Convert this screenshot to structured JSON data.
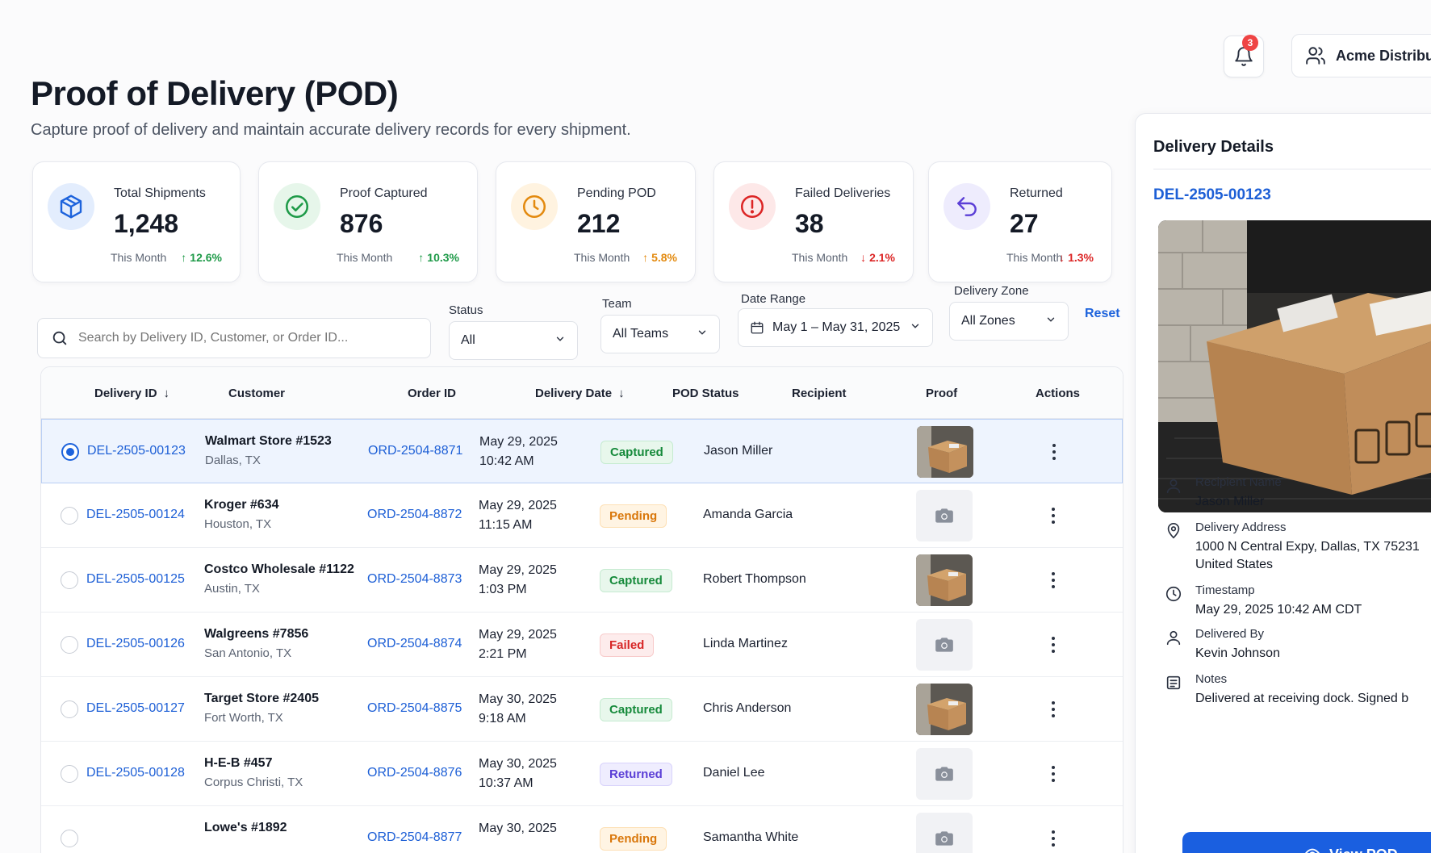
{
  "header": {
    "title": "Proof of Delivery (POD)",
    "subtitle": "Capture proof of delivery and maintain accurate delivery records for every shipment."
  },
  "topbar": {
    "notification_count": "3",
    "org_name": "Acme Distributi"
  },
  "stats": [
    {
      "label": "Total Shipments",
      "value": "1,248",
      "period": "This Month",
      "change": "12.6%",
      "direction": "up",
      "color": "#1e9a48",
      "icon": "cube-icon"
    },
    {
      "label": "Proof Captured",
      "value": "876",
      "period": "This Month",
      "change": "10.3%",
      "direction": "up",
      "color": "#1e9a48",
      "icon": "check-circle-icon"
    },
    {
      "label": "Pending POD",
      "value": "212",
      "period": "This Month",
      "change": "5.8%",
      "direction": "up",
      "color": "#e38a0f",
      "icon": "clock-icon"
    },
    {
      "label": "Failed Deliveries",
      "value": "38",
      "period": "This Month",
      "change": "2.1%",
      "direction": "down",
      "color": "#dc2626",
      "icon": "alert-circle-icon"
    },
    {
      "label": "Returned",
      "value": "27",
      "period": "This Month",
      "change": "1.3%",
      "direction": "down",
      "color": "#dc2626",
      "icon": "return-arrow-icon"
    }
  ],
  "filters": {
    "search_placeholder": "Search by Delivery ID, Customer, or Order ID...",
    "status_label": "Status",
    "status_value": "All",
    "team_label": "Team",
    "team_value": "All Teams",
    "date_label": "Date Range",
    "date_value": "May 1 – May 31, 2025",
    "zone_label": "Delivery Zone",
    "zone_value": "All Zones",
    "reset_label": "Reset"
  },
  "table": {
    "columns": {
      "delivery_id": "Delivery ID",
      "customer": "Customer",
      "order_id": "Order ID",
      "delivery_date": "Delivery Date",
      "pod_status": "POD Status",
      "recipient": "Recipient",
      "proof": "Proof",
      "actions": "Actions"
    },
    "rows": [
      {
        "id": "DEL-2505-00123",
        "customer": "Walmart Store #1523",
        "city": "Dallas, TX",
        "order": "ORD-2504-8871",
        "date": "May 29, 2025",
        "time": "10:42 AM",
        "status": "Captured",
        "status_class": "captured",
        "recipient": "Jason Miller",
        "proof": "photo",
        "selected": true
      },
      {
        "id": "DEL-2505-00124",
        "customer": "Kroger #634",
        "city": "Houston, TX",
        "order": "ORD-2504-8872",
        "date": "May 29, 2025",
        "time": "11:15 AM",
        "status": "Pending",
        "status_class": "pending",
        "recipient": "Amanda Garcia",
        "proof": "empty",
        "selected": false
      },
      {
        "id": "DEL-2505-00125",
        "customer": "Costco Wholesale #1122",
        "city": "Austin, TX",
        "order": "ORD-2504-8873",
        "date": "May 29, 2025",
        "time": "1:03 PM",
        "status": "Captured",
        "status_class": "captured",
        "recipient": "Robert Thompson",
        "proof": "photo",
        "selected": false
      },
      {
        "id": "DEL-2505-00126",
        "customer": "Walgreens #7856",
        "city": "San Antonio, TX",
        "order": "ORD-2504-8874",
        "date": "May 29, 2025",
        "time": "2:21 PM",
        "status": "Failed",
        "status_class": "failed",
        "recipient": "Linda Martinez",
        "proof": "empty",
        "selected": false
      },
      {
        "id": "DEL-2505-00127",
        "customer": "Target Store #2405",
        "city": "Fort Worth, TX",
        "order": "ORD-2504-8875",
        "date": "May 30, 2025",
        "time": "9:18 AM",
        "status": "Captured",
        "status_class": "captured",
        "recipient": "Chris Anderson",
        "proof": "photo",
        "selected": false
      },
      {
        "id": "DEL-2505-00128",
        "customer": "H-E-B #457",
        "city": "Corpus Christi, TX",
        "order": "ORD-2504-8876",
        "date": "May 30, 2025",
        "time": "10:37 AM",
        "status": "Returned",
        "status_class": "returned",
        "recipient": "Daniel Lee",
        "proof": "empty",
        "selected": false
      },
      {
        "id": "",
        "customer": "Lowe's #1892",
        "city": "",
        "order": "ORD-2504-8877",
        "date": "May 30, 2025",
        "time": "",
        "status": "Pending",
        "status_class": "pending",
        "recipient": "Samantha White",
        "proof": "empty",
        "selected": false
      }
    ]
  },
  "details": {
    "title": "Delivery Details",
    "delivery_id": "DEL-2505-00123",
    "recipient_label": "Recipient Name",
    "recipient_value": "Jason Miller",
    "address_label": "Delivery Address",
    "address_line1": "1000 N Central Expy, Dallas, TX 75231",
    "address_line2": "United States",
    "timestamp_label": "Timestamp",
    "timestamp_value": "May 29, 2025 10:42 AM CDT",
    "delivered_by_label": "Delivered By",
    "delivered_by_value": "Kevin Johnson",
    "notes_label": "Notes",
    "notes_value": "Delivered at receiving dock. Signed b",
    "view_button": "View POD"
  },
  "colors": {
    "primary": "#1d63dc",
    "success": "#1e9a48",
    "warning": "#e38a0f",
    "danger": "#dc2626",
    "purple": "#5b3fd6"
  }
}
